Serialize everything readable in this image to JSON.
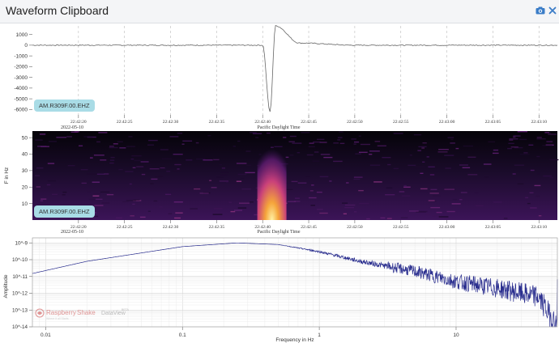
{
  "window": {
    "title": "Waveform Clipboard",
    "icons": [
      "camera-icon",
      "close-icon"
    ],
    "accent": "#3a7cc7"
  },
  "waveform": {
    "channel_label": "AM.R309F.00.EHZ",
    "y_ticks": [
      "1000",
      "0",
      "-1000",
      "-2000",
      "-3000",
      "-4000",
      "-5000",
      "-6000"
    ],
    "y_values": [
      1000,
      0,
      -1000,
      -2000,
      -3000,
      -4000,
      -5000,
      -6000
    ],
    "time_ticks": [
      "22:42:20",
      "22:42:25",
      "22:42:30",
      "22:42:35",
      "22:42:40",
      "22:42:45",
      "22:42:50",
      "22:42:55",
      "22:43:00",
      "22:43:05",
      "22:43:10"
    ],
    "date": "2022-05-10",
    "time_zone": "Pacific Daylight Time",
    "line_color": "#666666"
  },
  "spectrogram": {
    "channel_label": "AM.R309F.00.EHZ",
    "y_axis_label": "F in Hz",
    "y_ticks": [
      "50",
      "40",
      "30",
      "20",
      "10"
    ],
    "y_values": [
      50,
      40,
      30,
      20,
      10
    ],
    "time_ticks": [
      "22:42:20",
      "22:42:25",
      "22:42:30",
      "22:42:35",
      "22:42:40",
      "22:42:45",
      "22:42:50",
      "22:42:55",
      "22:43:00",
      "22:43:05",
      "22:43:10"
    ],
    "date": "2022-05-10",
    "time_zone": "Pacific Daylight Time"
  },
  "spectrum": {
    "y_axis_label": "Amplitude",
    "x_axis_label": "Frequency in Hz",
    "y_ticks": [
      "10^-9",
      "10^-10",
      "10^-11",
      "10^-12",
      "10^-13",
      "10^-14"
    ],
    "x_ticks": [
      "0.01",
      "0.1",
      "1",
      "10"
    ],
    "brand_name_a": "Raspberry",
    "brand_name_b": "Shake",
    "brand_product": "DataView",
    "brand_tag": "BETA",
    "brand_sub": "Where it all Starts",
    "line_color": "#2b2f8f"
  },
  "chart_data": [
    {
      "type": "line",
      "title": "",
      "series": [
        {
          "name": "AM.R309F.00.EHZ",
          "shape": "waveform"
        }
      ],
      "x": [
        "22:42:20",
        "22:42:25",
        "22:42:30",
        "22:42:35",
        "22:42:40",
        "22:42:45",
        "22:42:50",
        "22:42:55",
        "22:43:00",
        "22:43:05",
        "22:43:10"
      ],
      "points": [
        {
          "t": "22:42:15",
          "y": 0
        },
        {
          "t": "22:42:40",
          "y": 0
        },
        {
          "t": "22:42:40.8",
          "y": -6200
        },
        {
          "t": "22:42:41.4",
          "y": 1800
        },
        {
          "t": "22:42:44",
          "y": 200
        },
        {
          "t": "22:42:50",
          "y": 0
        },
        {
          "t": "22:43:12",
          "y": 0
        }
      ],
      "xlabel": "Pacific Daylight Time",
      "ylabel": "",
      "ylim": [
        -6500,
        1800
      ],
      "grid": true
    },
    {
      "type": "heatmap",
      "ylabel": "F in Hz",
      "xlabel": "Pacific Daylight Time",
      "ylim": [
        0,
        54
      ],
      "hot_spot": {
        "t": "22:42:41",
        "f_range": [
          0,
          12
        ]
      }
    },
    {
      "type": "line",
      "xlabel": "Frequency in Hz",
      "ylabel": "Amplitude",
      "x_scale": "log",
      "y_scale": "log",
      "xlim": [
        0.008,
        55
      ],
      "ylim": [
        1e-14,
        2e-09
      ],
      "points": [
        {
          "f": 0.008,
          "a": 1.5e-11
        },
        {
          "f": 0.02,
          "a": 8e-11
        },
        {
          "f": 0.1,
          "a": 6e-10
        },
        {
          "f": 0.25,
          "a": 1e-09
        },
        {
          "f": 0.5,
          "a": 8e-10
        },
        {
          "f": 1,
          "a": 3e-10
        },
        {
          "f": 2,
          "a": 8e-11
        },
        {
          "f": 5,
          "a": 2e-11
        },
        {
          "f": 10,
          "a": 5e-12
        },
        {
          "f": 20,
          "a": 2e-12
        },
        {
          "f": 40,
          "a": 6e-13
        },
        {
          "f": 55,
          "a": 1e-14
        }
      ],
      "grid": true
    }
  ]
}
